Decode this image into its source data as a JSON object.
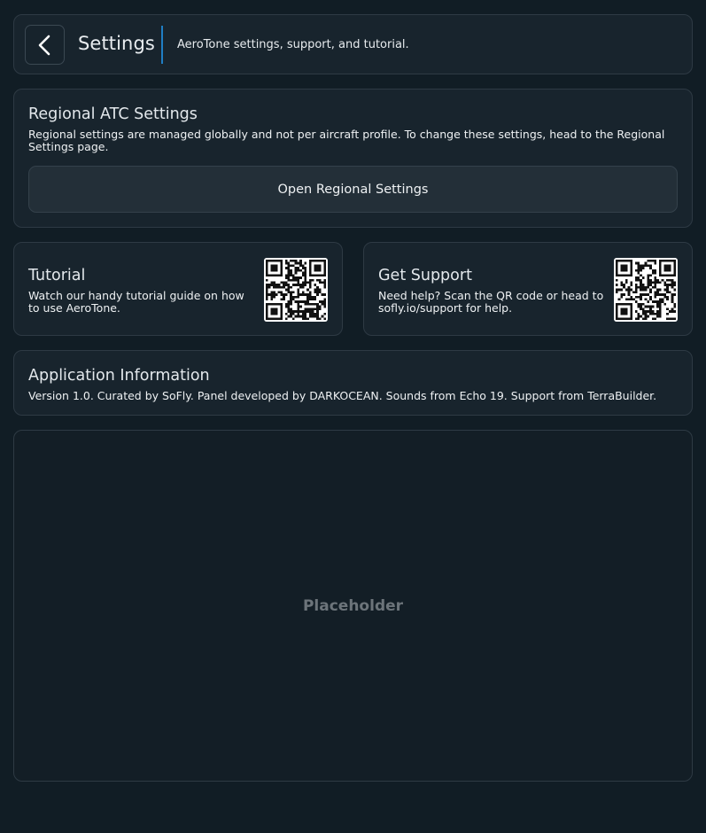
{
  "header": {
    "title": "Settings",
    "subtitle": "AeroTone settings, support, and tutorial.",
    "back_icon": "chevron-left-icon",
    "accent_color": "#1f7ec4"
  },
  "regional": {
    "title": "Regional ATC Settings",
    "description": "Regional settings are managed globally and not per aircraft profile. To change these settings, head to the Regional Settings page.",
    "button_label": "Open Regional Settings"
  },
  "tutorial": {
    "title": "Tutorial",
    "description": "Watch our handy tutorial guide on how to use AeroTone."
  },
  "support": {
    "title": "Get Support",
    "description": "Need help? Scan the QR code or head to sofly.io/support for help."
  },
  "app_info": {
    "title": "Application Information",
    "description": "Version 1.0. Curated by SoFly. Panel developed by DARKOCEAN. Sounds from Echo 19. Support from TerraBuilder."
  },
  "placeholder": {
    "label": "Placeholder"
  }
}
